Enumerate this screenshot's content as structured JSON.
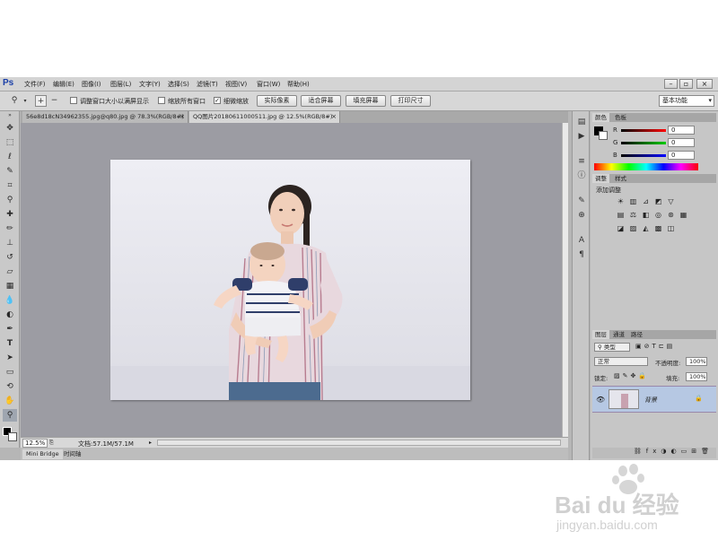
{
  "app": {
    "logo": "Ps",
    "menus": [
      "文件(F)",
      "编辑(E)",
      "图像(I)",
      "图层(L)",
      "文字(Y)",
      "选择(S)",
      "滤镜(T)",
      "视图(V)",
      "窗口(W)",
      "帮助(H)"
    ]
  },
  "options": {
    "fit_window_label": "调整窗口大小以满屏显示",
    "zoom_all_label": "缩放所有窗口",
    "scrubby_zoom_label": "细微缩放",
    "actual_pixels": "实际像素",
    "fit_screen": "适合屏幕",
    "fill_screen": "填充屏幕",
    "print_size": "打印尺寸",
    "workspace": "基本功能",
    "zoom_all_checked": false,
    "fit_window_checked": false,
    "scrubby_checked": true
  },
  "tabs": [
    {
      "label": "56e8d18cN34962355.jpg@q80.jpg @ 78.3%(RGB/8#)"
    },
    {
      "label": "QQ图片20180611000511.jpg @ 12.5%(RGB/8#)"
    }
  ],
  "status": {
    "zoom": "12.5%",
    "doc_info": "文档:57.1M/57.1M"
  },
  "bottom_tabs": [
    "Mini Bridge",
    "时间轴"
  ],
  "color_panel": {
    "tabs": [
      "颜色",
      "色板"
    ],
    "channels": [
      {
        "label": "R",
        "value": "0",
        "color": "#d02020"
      },
      {
        "label": "G",
        "value": "0",
        "color": "#20a020"
      },
      {
        "label": "B",
        "value": "0",
        "color": "#2030d0"
      }
    ]
  },
  "adjust_panel": {
    "tabs": [
      "调整",
      "样式"
    ],
    "title": "添加调整"
  },
  "layers_panel": {
    "tabs": [
      "图层",
      "通道",
      "路径"
    ],
    "filter": "类型",
    "blend_mode": "正常",
    "opacity_label": "不透明度:",
    "opacity": "100%",
    "lock_label": "锁定:",
    "fill_label": "填充:",
    "fill": "100%",
    "layer_name": "背景"
  },
  "watermark": {
    "line1": "Bai du 经验",
    "line2": "jingyan.baidu.com"
  }
}
